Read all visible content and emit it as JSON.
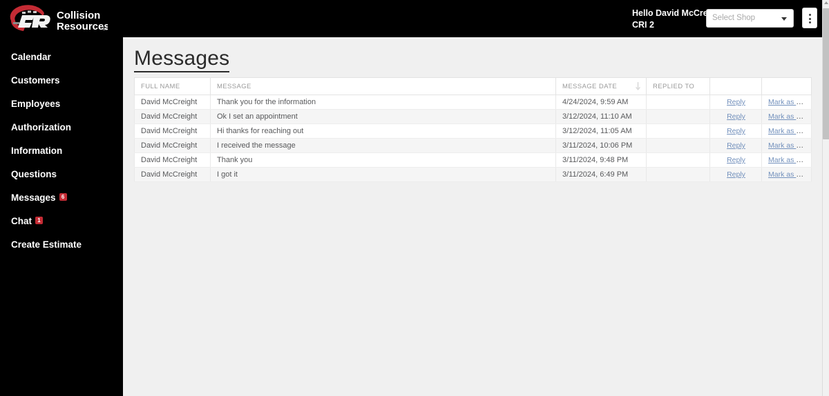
{
  "brand": {
    "logo_initials": "CR",
    "logo_line1": "Collision",
    "logo_line2": "Resources",
    "logo_tm": "tm"
  },
  "topbar": {
    "greeting": "Hello David McCreight",
    "org": "CRI 2",
    "shop_select_placeholder": "Select Shop",
    "shop_select_value": "",
    "kebab_label": "More options"
  },
  "sidebar": {
    "items": [
      {
        "label": "Calendar",
        "badge": ""
      },
      {
        "label": "Customers",
        "badge": ""
      },
      {
        "label": "Employees",
        "badge": ""
      },
      {
        "label": "Authorization",
        "badge": ""
      },
      {
        "label": "Information",
        "badge": ""
      },
      {
        "label": "Questions",
        "badge": ""
      },
      {
        "label": "Messages",
        "badge": "6"
      },
      {
        "label": "Chat",
        "badge": "1"
      },
      {
        "label": "Create Estimate",
        "badge": ""
      }
    ]
  },
  "main": {
    "page_title": "Messages"
  },
  "table": {
    "columns": [
      "FULL NAME",
      "MESSAGE",
      "MESSAGE DATE",
      "REPLIED TO",
      "",
      ""
    ],
    "sort_column": "MESSAGE DATE",
    "sort_direction": "descending",
    "reply_label": "Reply",
    "mark_read_label": "Mark as Read",
    "rows": [
      {
        "full_name": "David McCreight",
        "message": "Thank you for the information",
        "message_date": "4/24/2024, 9:59 AM",
        "replied_to": ""
      },
      {
        "full_name": "David McCreight",
        "message": "Ok I set an appointment",
        "message_date": "3/12/2024, 11:10 AM",
        "replied_to": ""
      },
      {
        "full_name": "David McCreight",
        "message": "Hi thanks for reaching out",
        "message_date": "3/12/2024, 11:05 AM",
        "replied_to": ""
      },
      {
        "full_name": "David McCreight",
        "message": "I received the message",
        "message_date": "3/11/2024, 10:06 PM",
        "replied_to": ""
      },
      {
        "full_name": "David McCreight",
        "message": "Thank you",
        "message_date": "3/11/2024, 9:48 PM",
        "replied_to": ""
      },
      {
        "full_name": "David McCreight",
        "message": "I got it",
        "message_date": "3/11/2024, 6:49 PM",
        "replied_to": ""
      }
    ]
  },
  "colors": {
    "sidebar_bg": "#000000",
    "content_bg": "#f0f0f0",
    "badge_red": "#c42b34",
    "link_blue": "#7290bc",
    "row_stripe": "#f5f5f5"
  }
}
